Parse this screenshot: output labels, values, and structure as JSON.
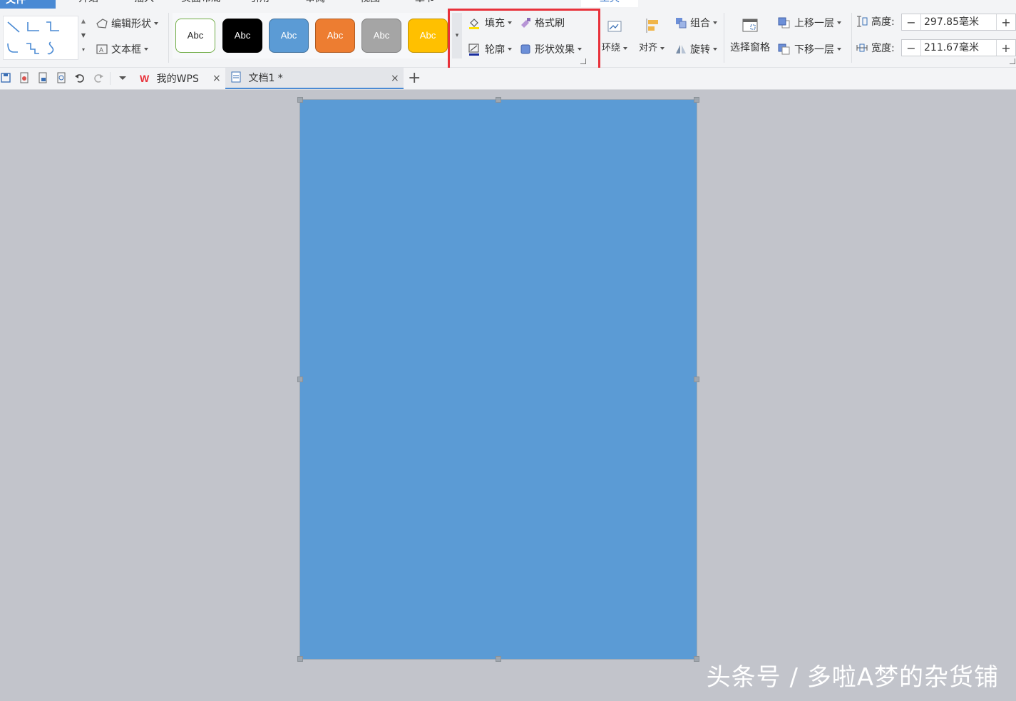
{
  "tabs": {
    "file": "文件",
    "items": [
      "开始",
      "插入",
      "页面布局",
      "引用",
      "审阅",
      "视图",
      "章节"
    ],
    "active": "工具"
  },
  "ribbon": {
    "edit_shape": "编辑形状",
    "text_box": "文本框",
    "styles": [
      {
        "label": "Abc",
        "bg": "#ffffff",
        "fg": "#222222",
        "border": "#71ad47"
      },
      {
        "label": "Abc",
        "bg": "#000000",
        "fg": "#ffffff",
        "border": "#000000"
      },
      {
        "label": "Abc",
        "bg": "#5b9bd5",
        "fg": "#ffffff",
        "border": "#41719c"
      },
      {
        "label": "Abc",
        "bg": "#ed7d31",
        "fg": "#ffffff",
        "border": "#ae5a21"
      },
      {
        "label": "Abc",
        "bg": "#a5a5a5",
        "fg": "#ffffff",
        "border": "#7f7f7f"
      },
      {
        "label": "Abc",
        "bg": "#ffc000",
        "fg": "#ffffff",
        "border": "#c09100"
      }
    ],
    "fill": "填充",
    "format_painter": "格式刷",
    "outline": "轮廓",
    "shape_effect": "形状效果",
    "wrap": "环绕",
    "align": "对齐",
    "group": "组合",
    "rotate": "旋转",
    "selection_pane": "选择窗格",
    "bring_forward": "上移一层",
    "send_backward": "下移一层",
    "height_label": "高度:",
    "height_value": "297.85毫米",
    "width_label": "宽度:",
    "width_value": "211.67毫米",
    "minus": "−",
    "plus": "+"
  },
  "doc_tabs": {
    "wps": "我的WPS",
    "doc": "文档1 *",
    "close": "×",
    "new": "+"
  },
  "colors": {
    "shape_fill": "#5b9bd5",
    "highlight": "#e8313a",
    "accent": "#4a8ad4"
  },
  "watermark": "头条号 / 多啦A梦的杂货铺"
}
